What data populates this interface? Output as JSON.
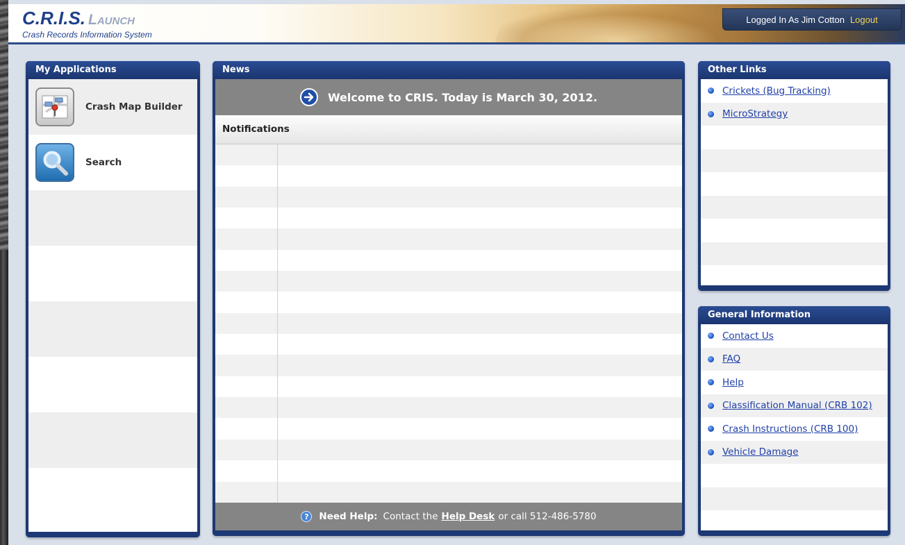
{
  "header": {
    "logo_main": "C.R.I.S.",
    "logo_launch": "Launch",
    "logo_subtitle": "Crash Records Information System",
    "logged_in_text": "Logged In As Jim Cotton",
    "logout_label": "Logout"
  },
  "apps_panel": {
    "title": "My Applications",
    "items": [
      {
        "label": "Crash Map Builder",
        "icon": "map-icon"
      },
      {
        "label": "Search",
        "icon": "magnifier-icon"
      }
    ]
  },
  "news_panel": {
    "title": "News",
    "welcome": "Welcome to CRIS.  Today is March 30, 2012.",
    "notifications_header": "Notifications",
    "help": {
      "need_help": "Need Help:",
      "contact_the": "Contact the",
      "help_desk": "Help Desk",
      "or_call": "or call 512-486-5780"
    }
  },
  "other_links": {
    "title": "Other Links",
    "items": [
      "Crickets (Bug Tracking)",
      "MicroStrategy"
    ]
  },
  "general_info": {
    "title": "General Information",
    "items": [
      "Contact Us",
      "FAQ",
      "Help",
      "Classification Manual (CRB 102)",
      "Crash Instructions (CRB 100)",
      "Vehicle Damage"
    ]
  },
  "colors": {
    "panel_navy": "#1d3874",
    "link_blue": "#1f3fa8",
    "logout_yellow": "#f3d35a",
    "bar_gray": "#858585"
  }
}
